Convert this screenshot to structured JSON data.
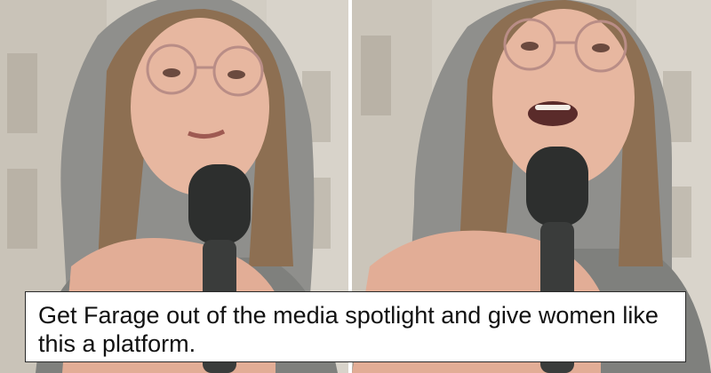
{
  "caption": {
    "text": "Get Farage out of the media spotlight and give women like this a platform."
  },
  "colors": {
    "background": "#ffffff",
    "caption_border": "#2a2a2a",
    "caption_text": "#111111",
    "hoodie": "#8f8f8c",
    "microphone": "#2d2f2e",
    "building": "#d2cdc3"
  },
  "photos": [
    {
      "subject": "woman-in-grey-hoodie-with-glasses",
      "mouth": "closed"
    },
    {
      "subject": "woman-in-grey-hoodie-with-glasses",
      "mouth": "open"
    }
  ]
}
